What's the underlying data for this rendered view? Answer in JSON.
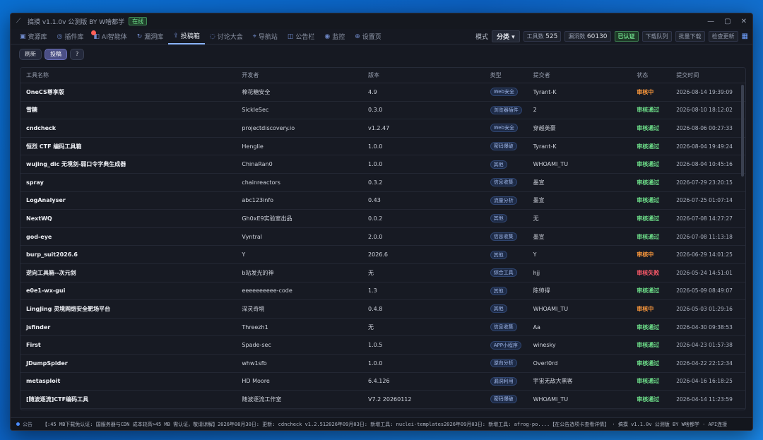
{
  "window": {
    "title": "搞摸 v1.1.0v 公测版 BY W啥都学",
    "status_badge": "在线",
    "controls": {
      "minimize": "—",
      "maximize": "▢",
      "close": "✕"
    }
  },
  "nav": {
    "tabs": [
      {
        "icon": "▣",
        "label": "资源库"
      },
      {
        "icon": "◎",
        "label": "插件库"
      },
      {
        "icon": "◧",
        "label": "AI智能体"
      },
      {
        "icon": "↻",
        "label": "漏洞库"
      },
      {
        "icon": "⇪",
        "label": "投稿箱"
      },
      {
        "icon": "◌",
        "label": "讨论大会"
      },
      {
        "icon": "⌖",
        "label": "导航站"
      },
      {
        "icon": "◫",
        "label": "公告栏"
      },
      {
        "icon": "◉",
        "label": "监控"
      },
      {
        "icon": "⊕",
        "label": "设置页"
      }
    ],
    "right": {
      "mode_label": "模式",
      "mode_value": "分类 ▾",
      "stat1_label": "工具数",
      "stat1_value": "525",
      "stat2_label": "漏洞数",
      "stat2_value": "60130",
      "verified": "已认证",
      "btn_queue": "下载队列",
      "btn_batch": "批量下载",
      "btn_check": "检查更新",
      "grid_icon": "▦"
    }
  },
  "toolbar": {
    "refresh": "刷新",
    "submit": "投稿",
    "help": "?"
  },
  "table": {
    "headers": [
      "工具名称",
      "开发者",
      "版本",
      "类型",
      "提交者",
      "状态",
      "提交时间"
    ],
    "rows": [
      {
        "name": "OneCS尊享版",
        "dev": "棉花糖安全",
        "ver": "4.9",
        "type": "Web安全",
        "submitter": "Tyrant-K",
        "status": "审核中",
        "st": "pend",
        "time": "2026-08-14 19:39:09"
      },
      {
        "name": "雪糖",
        "dev": "SickleSec",
        "ver": "0.3.0",
        "type": "浏览器插件",
        "submitter": "2",
        "status": "审核通过",
        "st": "ok",
        "time": "2026-08-10 18:12:02"
      },
      {
        "name": "cndcheck",
        "dev": "projectdiscovery.io",
        "ver": "v1.2.47",
        "type": "Web安全",
        "submitter": "穿越英豪",
        "status": "审核通过",
        "st": "ok",
        "time": "2026-08-06 00:27:33"
      },
      {
        "name": "恒烈 CTF 编码工具箱",
        "dev": "Henglie",
        "ver": "1.0.0",
        "type": "密码爆破",
        "submitter": "Tyrant-K",
        "status": "审核通过",
        "st": "ok",
        "time": "2026-08-04 19:49:24"
      },
      {
        "name": "wujing_dic 无境剑-弱口令字典生成器",
        "dev": "ChinaRan0",
        "ver": "1.0.0",
        "type": "其他",
        "submitter": "WHOAMI_TU",
        "status": "审核通过",
        "st": "ok",
        "time": "2026-08-04 10:45:16"
      },
      {
        "name": "spray",
        "dev": "chainreactors",
        "ver": "0.3.2",
        "type": "信息收集",
        "submitter": "墨宣",
        "status": "审核通过",
        "st": "ok",
        "time": "2026-07-29 23:20:15"
      },
      {
        "name": "LogAnalyser",
        "dev": "abc123info",
        "ver": "0.43",
        "type": "流量分析",
        "submitter": "墨宣",
        "status": "审核通过",
        "st": "ok",
        "time": "2026-07-25 01:07:14"
      },
      {
        "name": "NextWQ",
        "dev": "Gh0xE9实验室出品",
        "ver": "0.0.2",
        "type": "其他",
        "submitter": "无",
        "status": "审核通过",
        "st": "ok",
        "time": "2026-07-08 14:27:27"
      },
      {
        "name": "god-eye",
        "dev": "Vyntral",
        "ver": "2.0.0",
        "type": "信息收集",
        "submitter": "墨宣",
        "status": "审核通过",
        "st": "ok",
        "time": "2026-07-08 11:13:18"
      },
      {
        "name": "burp_suit2026.6",
        "dev": "Y",
        "ver": "2026.6",
        "type": "其他",
        "submitter": "Y",
        "status": "审核中",
        "st": "pend",
        "time": "2026-06-29 14:01:25"
      },
      {
        "name": "逆向工具箱--次元剑",
        "dev": "b站发光的神",
        "ver": "无",
        "type": "综合工具",
        "submitter": "hjj",
        "status": "审核失败",
        "st": "fail",
        "time": "2026-05-24 14:51:01"
      },
      {
        "name": "e0e1-wx-gui",
        "dev": "eeeeeeeeee-code",
        "ver": "1.3",
        "type": "其他",
        "submitter": "陈帅得",
        "status": "审核通过",
        "st": "ok",
        "time": "2026-05-09 08:49:07"
      },
      {
        "name": "LingJing 灵境网络安全靶场平台",
        "dev": "深灵奇境",
        "ver": "0.4.8",
        "type": "其他",
        "submitter": "WHOAMI_TU",
        "status": "审核中",
        "st": "pend",
        "time": "2026-05-03 01:29:16"
      },
      {
        "name": "jsfinder",
        "dev": "Threezh1",
        "ver": "无",
        "type": "信息收集",
        "submitter": "Aa",
        "status": "审核通过",
        "st": "ok",
        "time": "2026-04-30 09:38:53"
      },
      {
        "name": "First",
        "dev": "Spade-sec",
        "ver": "1.0.5",
        "type": "APP小程序",
        "submitter": "winesky",
        "status": "审核通过",
        "st": "ok",
        "time": "2026-04-23 01:57:38"
      },
      {
        "name": "JDumpSpider",
        "dev": "whw1sfb",
        "ver": "1.0.0",
        "type": "逆向分析",
        "submitter": "Overl0rd",
        "status": "审核通过",
        "st": "ok",
        "time": "2026-04-22 22:12:34"
      },
      {
        "name": "metasploit",
        "dev": "HD Moore",
        "ver": "6.4.126",
        "type": "漏洞利用",
        "submitter": "宇宙无敌大黑客",
        "status": "审核通过",
        "st": "ok",
        "time": "2026-04-16 16:18:25"
      },
      {
        "name": "[随波逐流]CTF编码工具",
        "dev": "随波逐流工作室",
        "ver": "V7.2 20260112",
        "type": "密码爆破",
        "submitter": "WHOAMI_TU",
        "status": "审核通过",
        "st": "ok",
        "time": "2026-04-14 11:23:59"
      }
    ]
  },
  "statusbar": {
    "label": "公告",
    "text": "【:45 MB下载免认证: 国服务器与CDN 成本较高>45 MB 需认证，敬请谅解】2026年08月30日: 更新: cdncheck v1.2.512026年09月03日: 新增工具: nuclei-templates2026年09月03日: 新增工具: afrog-po....【在公告选项卡查看详情】 · 搞摸 v1.1.0v 公测版 BY W啥都学 · API连接"
  }
}
